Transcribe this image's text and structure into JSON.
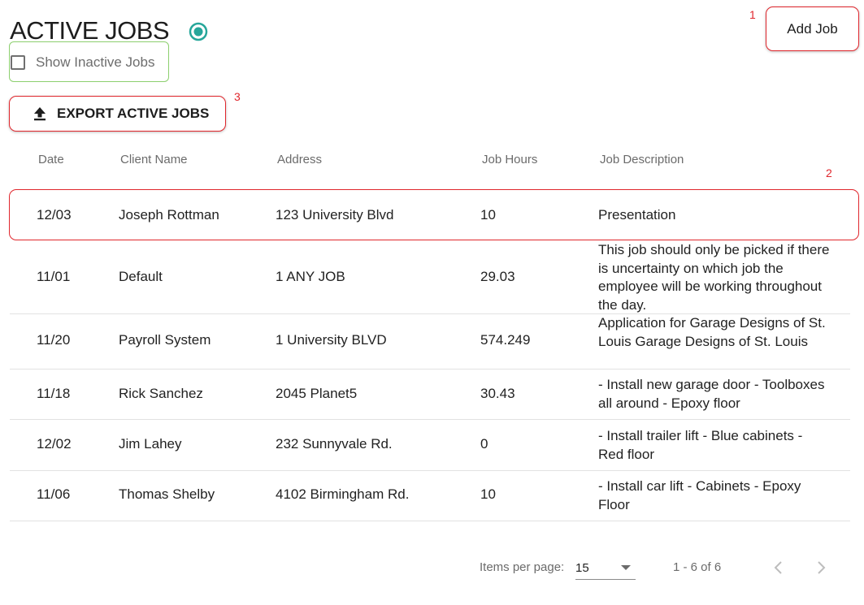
{
  "header": {
    "title": "ACTIVE JOBS",
    "show_inactive_label": "Show Inactive Jobs",
    "add_job_label": "Add Job",
    "export_label": "EXPORT ACTIVE JOBS"
  },
  "annotations": {
    "add_job": "1",
    "row": "2",
    "export": "3"
  },
  "table": {
    "columns": [
      "Date",
      "Client Name",
      "Address",
      "Job Hours",
      "Job Description"
    ],
    "rows": [
      [
        "12/03",
        "Joseph Rottman",
        "123 University Blvd",
        "10",
        "Presentation"
      ],
      [
        "11/01",
        "Default",
        "1 ANY JOB",
        "29.03",
        "This job should only be picked if there is uncertainty on which job the employee will be working throughout the day."
      ],
      [
        "11/20",
        "Payroll System",
        "1 University BLVD",
        "574.249",
        "Application for Garage Designs of St. Louis Garage Designs of St. Louis"
      ],
      [
        "11/18",
        "Rick Sanchez",
        "2045 Planet5",
        "30.43",
        "- Install new garage door - Toolboxes all around - Epoxy floor"
      ],
      [
        "12/02",
        "Jim Lahey",
        "232 Sunnyvale Rd.",
        "0",
        "- Install trailer lift - Blue cabinets - Red floor"
      ],
      [
        "11/06",
        "Thomas Shelby",
        "4102 Birmingham Rd.",
        "10",
        "- Install car lift - Cabinets - Epoxy Floor"
      ]
    ]
  },
  "paginator": {
    "items_per_page_label": "Items per page:",
    "items_per_page_value": "15",
    "range_label": "1 - 6 of 6"
  },
  "icons": {
    "active_indicator": "radio-checked-icon",
    "checkbox": "checkbox-unchecked-icon",
    "export": "upload-icon",
    "caret": "dropdown-caret-icon",
    "prev": "chevron-left-icon",
    "next": "chevron-right-icon"
  },
  "colors": {
    "accent_teal": "#26a69a",
    "annotation_red": "#e0262c",
    "inactive_highlight_green": "#8ccf6e"
  }
}
